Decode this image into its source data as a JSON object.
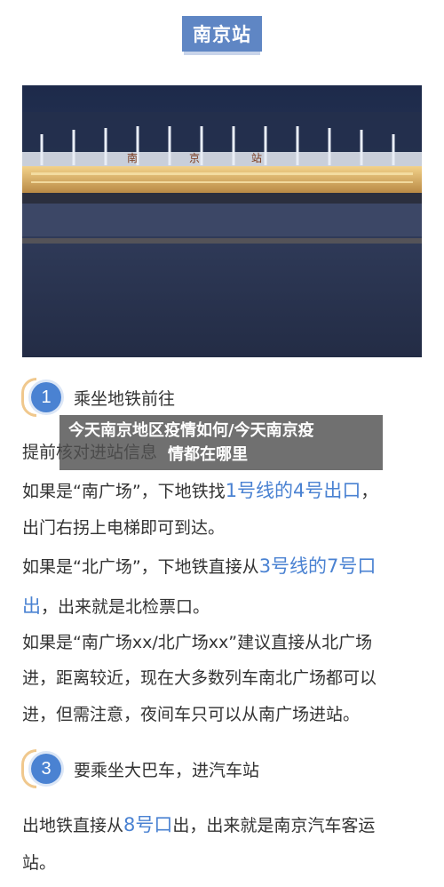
{
  "header": {
    "title": "南京站"
  },
  "photo": {
    "sign_chars": [
      "南",
      "京",
      "站"
    ]
  },
  "steps": [
    {
      "number": "1",
      "label": "乘坐地铁前往"
    },
    {
      "number": "3",
      "label": "要乘坐大巴车，进汽车站"
    }
  ],
  "overlay": {
    "line1": "今天南京地区疫情如何/今天南京疫",
    "line2": "情都在哪里"
  },
  "paragraphs": {
    "p0": "提前核对进站信息",
    "p1a": "如果是“南广场”，下地铁找",
    "p1b": "1号线的4号出口",
    "p1c": "，",
    "p2": "出门右拐上电梯即可到达。",
    "p3a": "如果是“北广场”，下地铁直接从",
    "p3b": "3号线的7号口",
    "p4a": "出",
    "p4b": "，出来就是北检票口。",
    "p5": "如果是“南广场xx/北广场xx”建议直接从北广场",
    "p6": "进，距离较近，现在大多数列车南北广场都可以",
    "p7": "进，但需注意，夜间车只可以从南广场进站。",
    "p8a": "出地铁直接从",
    "p8b": "8号口",
    "p8c": "出，出来就是南京汽车客运",
    "p9": "站。"
  },
  "colors": {
    "accent": "#4a82d2",
    "badge": "#5f86c4",
    "bracket": "#f0c88d"
  }
}
